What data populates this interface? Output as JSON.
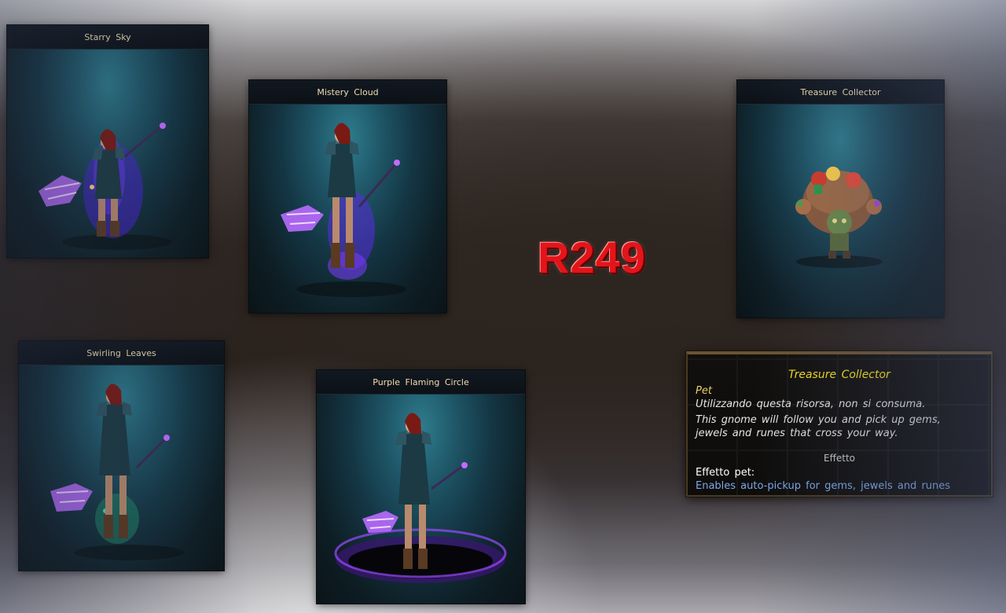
{
  "center_label": "R249",
  "cards": {
    "starry_sky": {
      "title": "Starry  Sky"
    },
    "mistery_cloud": {
      "title": "Mistery  Cloud"
    },
    "treasure_collector": {
      "title": "Treasure  Collector"
    },
    "swirling_leaves": {
      "title": "Swirling  Leaves"
    },
    "purple_flaming_circle": {
      "title": "Purple  Flaming  Circle"
    }
  },
  "tooltip": {
    "title": "Treasure Collector",
    "type": "Pet",
    "line1": "Utilizzando questa risorsa, non si consuma.",
    "line2": "This gnome will follow you and pick up gems,",
    "line3": "jewels and runes that cross your way.",
    "section": "Effetto",
    "effect_label": "Effetto pet:",
    "effect_value": "Enables auto-pickup for gems, jewels and runes"
  },
  "colors": {
    "header_text": "#f1ddb1",
    "label_red": "#e2151b",
    "tooltip_title": "#f5e01a",
    "tooltip_effect": "#7ea7e6"
  }
}
